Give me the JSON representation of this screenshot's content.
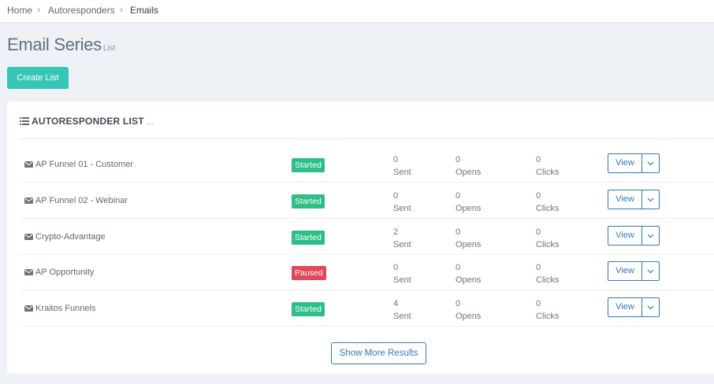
{
  "breadcrumb": {
    "home": "Home",
    "autoresponders": "Autoresponders",
    "emails": "Emails"
  },
  "page": {
    "title": "Email Series",
    "subtitle": "List",
    "create_button": "Create List"
  },
  "panel": {
    "title": "AUTORESPONDER LIST",
    "ellipsis": "...",
    "show_more": "Show More Results"
  },
  "colors": {
    "started": "#2dbf87",
    "paused": "#e2485a",
    "accent": "#36c6b5",
    "link": "#337ab7"
  },
  "list": [
    {
      "name": "AP Funnel 01 - Customer",
      "status": "Started",
      "sent": "0",
      "sent_label": "Sent",
      "opens": "0",
      "opens_label": "Opens",
      "clicks": "0",
      "clicks_label": "Clicks",
      "view": "View"
    },
    {
      "name": "AP Funnel 02 - Webinar",
      "status": "Started",
      "sent": "0",
      "sent_label": "Sent",
      "opens": "0",
      "opens_label": "Opens",
      "clicks": "0",
      "clicks_label": "Clicks",
      "view": "View"
    },
    {
      "name": "Crypto-Advantage",
      "status": "Started",
      "sent": "2",
      "sent_label": "Sent",
      "opens": "0",
      "opens_label": "Opens",
      "clicks": "0",
      "clicks_label": "Clicks",
      "view": "View"
    },
    {
      "name": "AP Opportunity",
      "status": "Paused",
      "sent": "0",
      "sent_label": "Sent",
      "opens": "0",
      "opens_label": "Opens",
      "clicks": "0",
      "clicks_label": "Clicks",
      "view": "View"
    },
    {
      "name": "Kraitos Funnels",
      "status": "Started",
      "sent": "4",
      "sent_label": "Sent",
      "opens": "0",
      "opens_label": "Opens",
      "clicks": "0",
      "clicks_label": "Clicks",
      "view": "View"
    }
  ]
}
